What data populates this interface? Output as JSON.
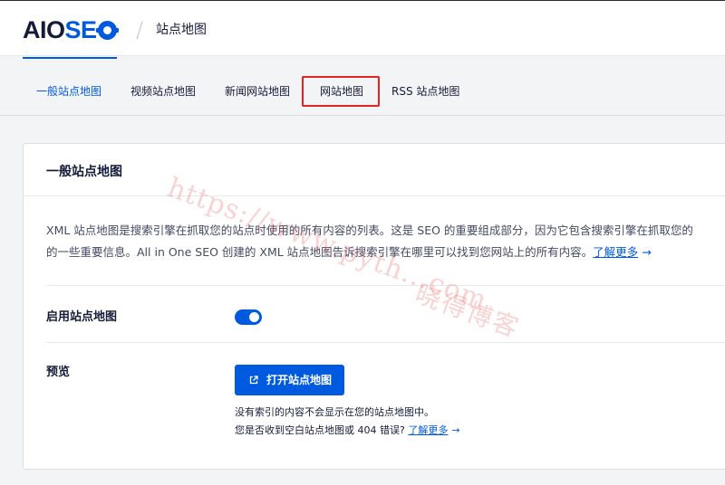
{
  "header": {
    "logo_part1": "AIO",
    "logo_part2": "SE",
    "separator": "/",
    "breadcrumb": "站点地图"
  },
  "tabs": [
    {
      "label": "一般站点地图",
      "active": true
    },
    {
      "label": "视频站点地图",
      "active": false
    },
    {
      "label": "新闻网站地图",
      "active": false
    },
    {
      "label": "网站地图",
      "active": false
    },
    {
      "label": "RSS 站点地图",
      "active": false
    }
  ],
  "card": {
    "title": "一般站点地图",
    "description_line1": "XML 站点地图是搜索引擎在抓取您的站点时使用的所有内容的列表。这是 SEO 的重要组成部分，因为它包含搜索引擎在抓取您的",
    "description_line2": "的一些重要信息。All in One SEO 创建的 XML 站点地图告诉搜索引擎在哪里可以找到您网站上的所有内容。",
    "learn_more": "了解更多",
    "learn_more_arrow": "→",
    "enable_label": "启用站点地图",
    "enable_value": true,
    "preview_label": "预览",
    "open_button": "打开站点地图",
    "note_line1": "没有索引的内容不会显示在您的站点地图中。",
    "note_line2": "您是否收到空白站点地图或 404 错误?",
    "note_learn_more": "了解更多",
    "note_arrow": "→"
  },
  "watermark": {
    "url": "https://www.pyth...com",
    "name": "晓得博客"
  },
  "colors": {
    "accent": "#005ae0",
    "highlight": "#e02424",
    "text": "#141b38"
  }
}
